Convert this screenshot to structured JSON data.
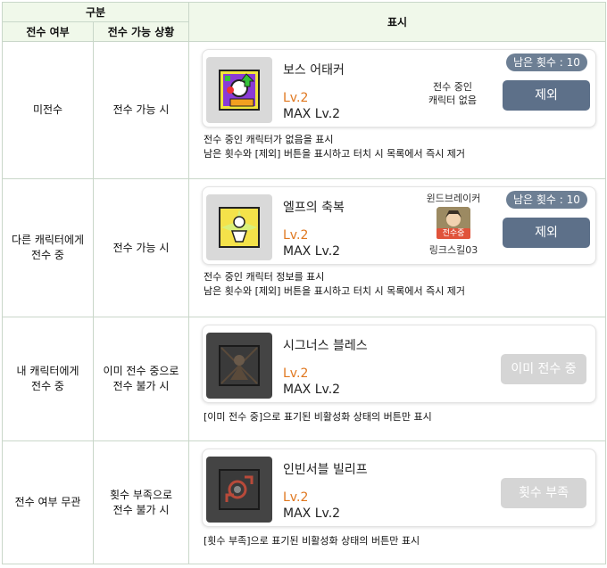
{
  "header": {
    "group": "구분",
    "col_status": "전수 여부",
    "col_situation": "전수 가능 상황",
    "col_display": "표시"
  },
  "rows": [
    {
      "status": "미전수",
      "situation": "전수 가능 시",
      "card": {
        "name": "보스 어태커",
        "level": "Lv.2",
        "max": "MAX Lv.2",
        "info_line1": "전수 중인",
        "info_line2": "캐릭터 없음",
        "remaining": "남은 횟수 : 10",
        "button": "제외",
        "icon": "boss-attacker-icon"
      },
      "desc1": "전수 중인 캐릭터가 없음을 표시",
      "desc2": "남은 횟수와 [제외] 버튼을 표시하고 터치 시 목록에서 즉시 제거"
    },
    {
      "status_line1": "다른 캐릭터에게",
      "status_line2": "전수 중",
      "situation": "전수 가능 시",
      "card": {
        "name": "엘프의 축복",
        "level": "Lv.2",
        "max": "MAX Lv.2",
        "job": "윈드브레이커",
        "badge": "전수중",
        "char_name": "링크스킬03",
        "remaining": "남은 횟수 : 10",
        "button": "제외",
        "icon": "elf-blessing-icon"
      },
      "desc1": "전수 중인 캐릭터 정보를 표시",
      "desc2": "남은 횟수와 [제외] 버튼을 표시하고 터치 시 목록에서 즉시 제거"
    },
    {
      "status_line1": "내 캐릭터에게",
      "status_line2": "전수 중",
      "situation_line1": "이미 전수 중으로",
      "situation_line2": "전수 불가 시",
      "card": {
        "name": "시그너스 블레스",
        "level": "Lv.2",
        "max": "MAX Lv.2",
        "button": "이미 전수 중",
        "icon": "cygnus-bless-icon"
      },
      "desc1": "[이미 전수 중]으로 표기된 비활성화 상태의 버튼만 표시"
    },
    {
      "status": "전수 여부 무관",
      "situation_line1": "횟수 부족으로",
      "situation_line2": "전수 불가 시",
      "card": {
        "name": "인빈서블 빌리프",
        "level": "Lv.2",
        "max": "MAX Lv.2",
        "button": "횟수 부족",
        "icon": "invincible-belief-icon"
      },
      "desc1": "[횟수 부족]으로 표기된 비활성화 상태의 버튼만 표시"
    }
  ],
  "colors": {
    "header_bg": "#f0f8ea",
    "border": "#c9d7c9",
    "level": "#e07820",
    "button": "#5d7089",
    "badge": "#6d7f94",
    "disabled": "#d5d5d5"
  }
}
